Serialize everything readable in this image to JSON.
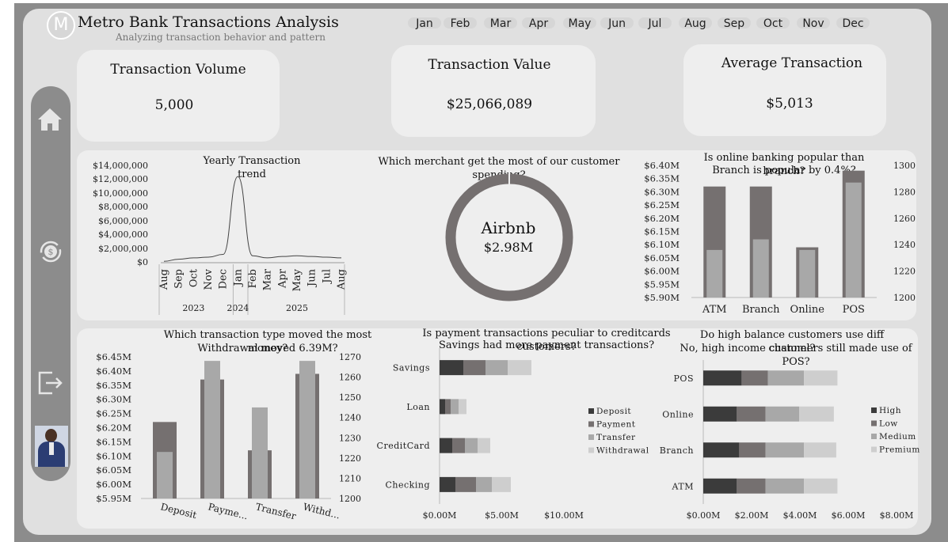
{
  "header": {
    "logo_letter": "M",
    "title": "Metro Bank Transactions Analysis",
    "subtitle": "Analyzing transaction behavior and pattern"
  },
  "months": [
    "Jan",
    "Feb",
    "Mar",
    "Apr",
    "May",
    "Jun",
    "Jul",
    "Aug",
    "Sep",
    "Oct",
    "Nov",
    "Dec"
  ],
  "kpis": [
    {
      "label": "Transaction Volume",
      "value": "5,000"
    },
    {
      "label": "Transaction Value",
      "value": "$25,066,089"
    },
    {
      "label": "Average Transaction",
      "value": "$5,013"
    }
  ],
  "sidebar": {
    "icons": [
      "home-icon",
      "currency-refresh-icon",
      "logout-icon",
      "avatar"
    ]
  },
  "colors": {
    "dark": "#3b3b3b",
    "mid_dark": "#757070",
    "mid": "#a8a8a8",
    "light": "#cecece",
    "panel": "#eeeeee",
    "frame": "#8c8c8c"
  },
  "charts": {
    "trend": {
      "title": "Yearly Transaction trend",
      "chart_data": {
        "type": "line",
        "title": "Yearly Transaction trend",
        "y_ticks": [
          "$14,000,000",
          "$12,000,000",
          "$10,000,000",
          "$8,000,000",
          "$6,000,000",
          "$4,000,000",
          "$2,000,000",
          "$0"
        ],
        "ylim": [
          0,
          14000000
        ],
        "x": [
          "Aug",
          "Sep",
          "Oct",
          "Nov",
          "Dec",
          "Jan",
          "Feb",
          "Mar",
          "Apr",
          "May",
          "Jun",
          "Jul",
          "Aug"
        ],
        "years": [
          {
            "label": "2023",
            "start": 0,
            "end": 4
          },
          {
            "label": "2024",
            "start": 5,
            "end": 5
          },
          {
            "label": "2025",
            "start": 6,
            "end": 12
          }
        ],
        "values": [
          200000,
          500000,
          700000,
          800000,
          1200000,
          12500000,
          1000000,
          700000,
          900000,
          1000000,
          900000,
          800000,
          700000
        ]
      }
    },
    "merchant": {
      "title": "Which merchant get the most of our customer spending?",
      "center_label": "Airbnb",
      "center_value": "$2.98M",
      "chart_data": {
        "type": "pie",
        "categories": [
          "Airbnb"
        ],
        "values": [
          2.98
        ],
        "unit": "M"
      }
    },
    "online_vs_branch": {
      "title_line1": "Is online banking popular than branch?",
      "title_line2": "Branch is popular by 0.4%?",
      "chart_data": {
        "type": "bar",
        "categories": [
          "ATM",
          "Branch",
          "Online",
          "POS"
        ],
        "series": [
          {
            "axis": "left",
            "values": [
              6.32,
              6.32,
              6.09,
              6.38
            ]
          },
          {
            "axis": "right",
            "values": [
              1236,
              1244,
              1236,
              1287
            ]
          }
        ],
        "y_left_ticks": [
          "$6.40M",
          "$6.35M",
          "$6.30M",
          "$6.25M",
          "$6.20M",
          "$6.15M",
          "$6.10M",
          "$6.05M",
          "$6.00M",
          "$5.95M",
          "$5.90M"
        ],
        "ylim_left": [
          5.9,
          6.4
        ],
        "y_right_ticks": [
          "1300",
          "1280",
          "1260",
          "1240",
          "1220",
          "1200"
        ],
        "ylim_right": [
          1200,
          1300
        ]
      }
    },
    "txn_type": {
      "title_line1": "Which transaction type moved the most money?",
      "title_line2": "Withdrawal moved 6.39M?",
      "chart_data": {
        "type": "bar",
        "categories": [
          "Deposit",
          "Payme...",
          "Transfer",
          "Withd..."
        ],
        "series": [
          {
            "axis": "left",
            "values": [
              6.22,
              6.37,
              6.12,
              6.39
            ]
          },
          {
            "axis": "right",
            "values": [
              1223,
              1268,
              1245,
              1268
            ]
          }
        ],
        "y_left_ticks": [
          "$6.45M",
          "$6.40M",
          "$6.35M",
          "$6.30M",
          "$6.25M",
          "$6.20M",
          "$6.15M",
          "$6.10M",
          "$6.05M",
          "$6.00M",
          "$5.95M"
        ],
        "ylim_left": [
          5.95,
          6.45
        ],
        "y_right_ticks": [
          "1270",
          "1260",
          "1250",
          "1240",
          "1230",
          "1220",
          "1210",
          "1200"
        ],
        "ylim_right": [
          1200,
          1270
        ]
      }
    },
    "account_payment": {
      "title_line1": "Is payment transactions peculiar to creditcards customers?",
      "title_line2": "Savings had more payment transactions?",
      "chart_data": {
        "type": "bar",
        "orientation": "horizontal",
        "stacked": true,
        "categories": [
          "Savings",
          "Loan",
          "CreditCard",
          "Checking"
        ],
        "series": [
          {
            "name": "Deposit",
            "values": [
              1.5,
              0.35,
              0.8,
              1.0
            ]
          },
          {
            "name": "Payment",
            "values": [
              1.4,
              0.35,
              0.8,
              1.3
            ]
          },
          {
            "name": "Transfer",
            "values": [
              1.4,
              0.5,
              0.8,
              1.0
            ]
          },
          {
            "name": "Withdrawal",
            "values": [
              1.5,
              0.5,
              0.8,
              1.2
            ]
          }
        ],
        "x_ticks": [
          "$0.00M",
          "$5.00M",
          "$10.00M"
        ],
        "xlim": [
          0,
          12
        ]
      }
    },
    "balance_channel": {
      "title_line1": "Do high balance customers use diff channel?",
      "title_line2": "No, high income customers still made use of POS?",
      "chart_data": {
        "type": "bar",
        "orientation": "horizontal",
        "stacked": true,
        "categories": [
          "POS",
          "Online",
          "Branch",
          "ATM"
        ],
        "series": [
          {
            "name": "High",
            "values": [
              1.6,
              1.4,
              1.5,
              1.4
            ]
          },
          {
            "name": "Low",
            "values": [
              1.1,
              1.2,
              1.1,
              1.2
            ]
          },
          {
            "name": "Medium",
            "values": [
              1.5,
              1.4,
              1.6,
              1.6
            ]
          },
          {
            "name": "Premium",
            "values": [
              1.4,
              1.45,
              1.35,
              1.4
            ]
          }
        ],
        "x_ticks": [
          "$0.00M",
          "$2.00M",
          "$4.00M",
          "$6.00M",
          "$8.00M"
        ],
        "xlim": [
          0,
          8
        ]
      }
    }
  }
}
